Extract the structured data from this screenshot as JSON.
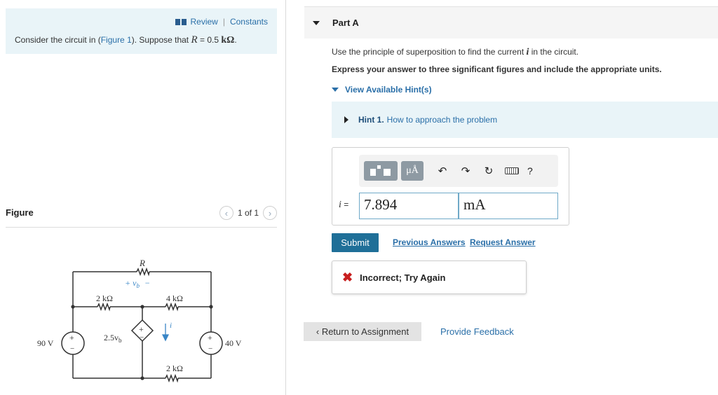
{
  "intro": {
    "review_label": "Review",
    "separator": "|",
    "constants_label": "Constants",
    "text_before_link": "Consider the circuit in (",
    "figure_link": "Figure 1",
    "text_after_link": "). Suppose that ",
    "var": "R",
    "eq_value": " = 0.5 ",
    "unit": "kΩ",
    "period": "."
  },
  "figure": {
    "label": "Figure",
    "pager_text": "1 of 1",
    "prev_glyph": "‹",
    "next_glyph": "›"
  },
  "circuit": {
    "R_label": "R",
    "vb_label": "+  v",
    "vb_sub": "b",
    "vb_minus": "−",
    "res_2k_top": "2 kΩ",
    "res_4k": "4 kΩ",
    "res_2k_bottom": "2 kΩ",
    "dep_source": "2.5v",
    "dep_sub": "b",
    "current_label": "i",
    "src_90": "90 V",
    "src_40": "40 V",
    "plus": "+",
    "minus": "−"
  },
  "part": {
    "title": "Part A",
    "instruction_before": "Use the principle of superposition to find the current ",
    "instruction_var": "i",
    "instruction_after": " in the circuit.",
    "express": "Express your answer to three significant figures and include the appropriate units.",
    "view_hints": "View Available Hint(s)",
    "hint_number": "Hint 1.",
    "hint_text": "How to approach the problem"
  },
  "answer": {
    "var": "i",
    "equals": " =",
    "value": "7.894",
    "unit": "mA",
    "mu_label": "μÅ",
    "undo_glyph": "↶",
    "redo_glyph": "↷",
    "reset_glyph": "↻",
    "help_glyph": "?"
  },
  "actions": {
    "submit": "Submit",
    "previous_answers": "Previous Answers",
    "request_answer": "Request Answer"
  },
  "feedback": {
    "icon": "✖",
    "text": "Incorrect; Try Again"
  },
  "footer": {
    "return_label": "‹ Return to Assignment",
    "provide_feedback": "Provide Feedback"
  },
  "colors": {
    "accent": "#2a6fa8",
    "submit_bg": "#1f6f98",
    "error": "#c81e1e",
    "hint_bg": "#e9f4f8"
  }
}
